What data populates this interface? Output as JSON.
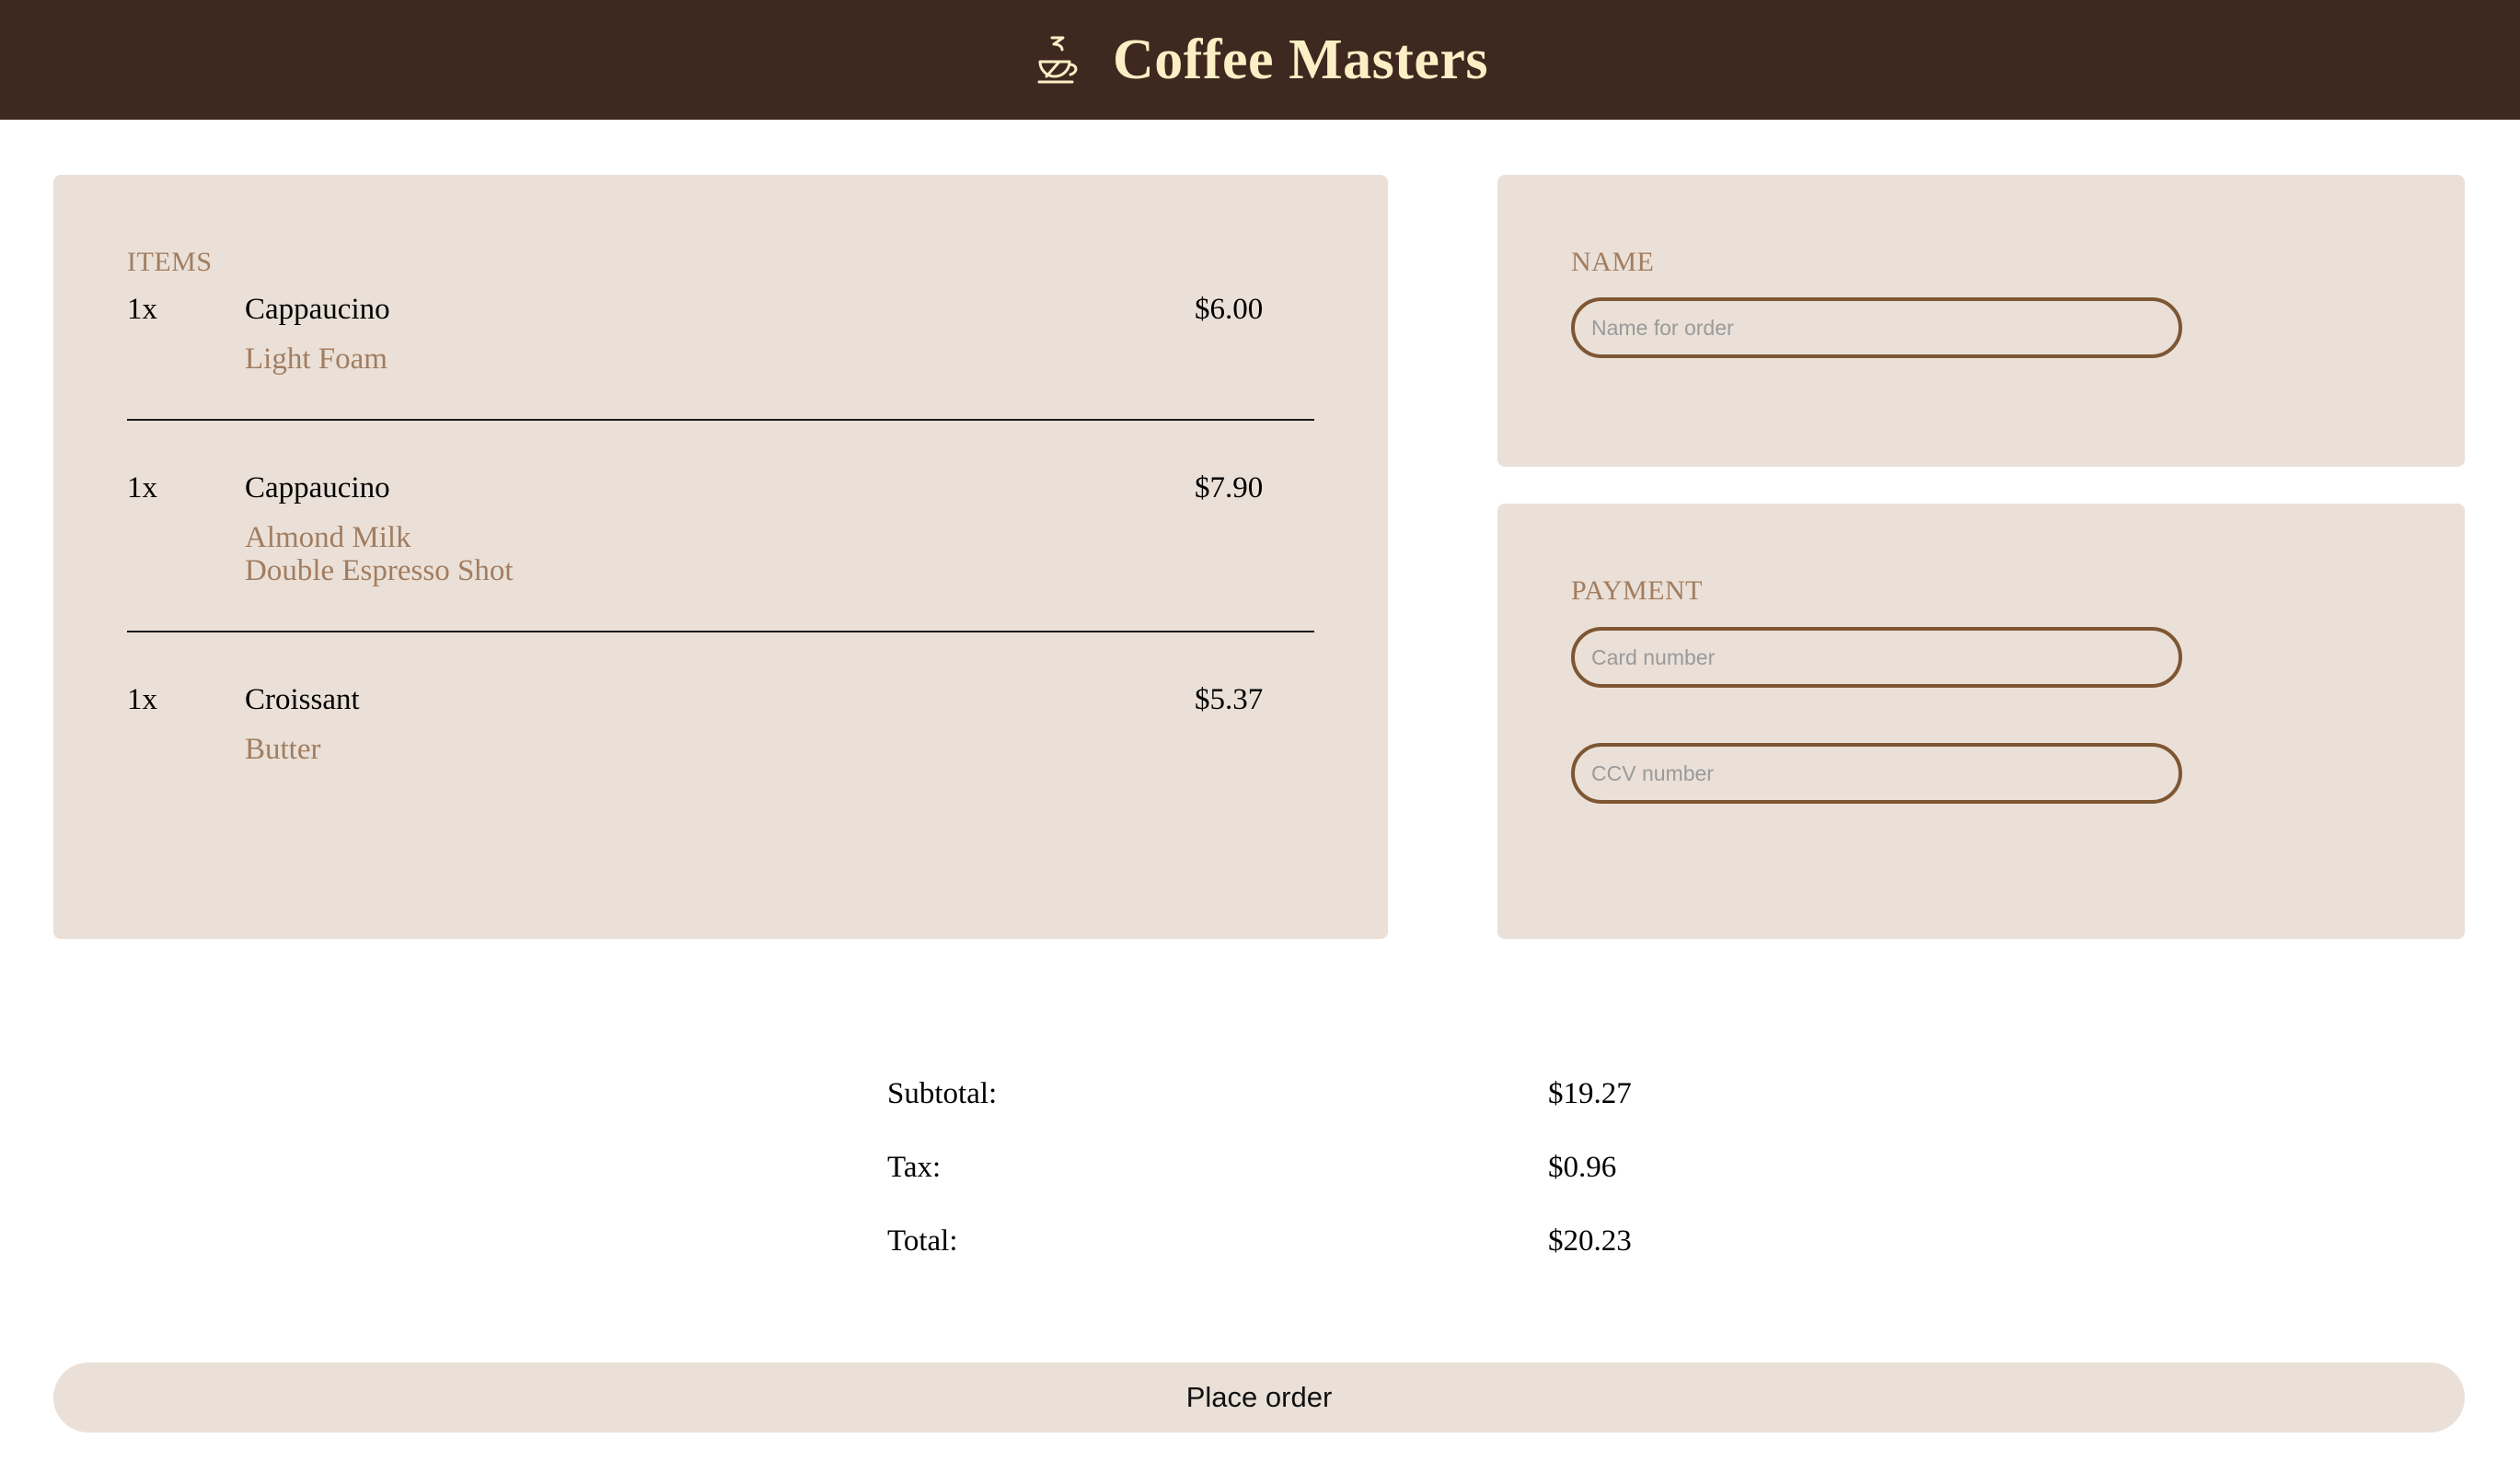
{
  "header": {
    "logo_icon": "coffee-cup-icon",
    "title": "Coffee Masters",
    "background_color": "#3e281f",
    "title_color": "#fcefc5"
  },
  "items_section": {
    "label": "ITEMS",
    "items": [
      {
        "qty": "1x",
        "name": "Cappaucino",
        "price": "$6.00",
        "modifiers": [
          "Light Foam"
        ]
      },
      {
        "qty": "1x",
        "name": "Cappaucino",
        "price": "$7.90",
        "modifiers": [
          "Almond Milk",
          "Double Espresso Shot"
        ]
      },
      {
        "qty": "1x",
        "name": "Croissant",
        "price": "$5.37",
        "modifiers": [
          "Butter"
        ]
      }
    ]
  },
  "name_section": {
    "label": "NAME",
    "name_placeholder": "Name for order",
    "name_value": ""
  },
  "payment_section": {
    "label": "PAYMENT",
    "card_placeholder": "Card number",
    "card_value": "",
    "ccv_placeholder": "CCV number",
    "ccv_value": ""
  },
  "totals": {
    "subtotal_label": "Subtotal:",
    "subtotal_value": "$19.27",
    "tax_label": "Tax:",
    "tax_value": "$0.96",
    "total_label": "Total:",
    "total_value": "$20.23"
  },
  "actions": {
    "place_order_label": "Place order"
  },
  "colors": {
    "panel_background": "#eae0d7",
    "accent_text": "#a27d60",
    "input_border": "#7e5633"
  }
}
